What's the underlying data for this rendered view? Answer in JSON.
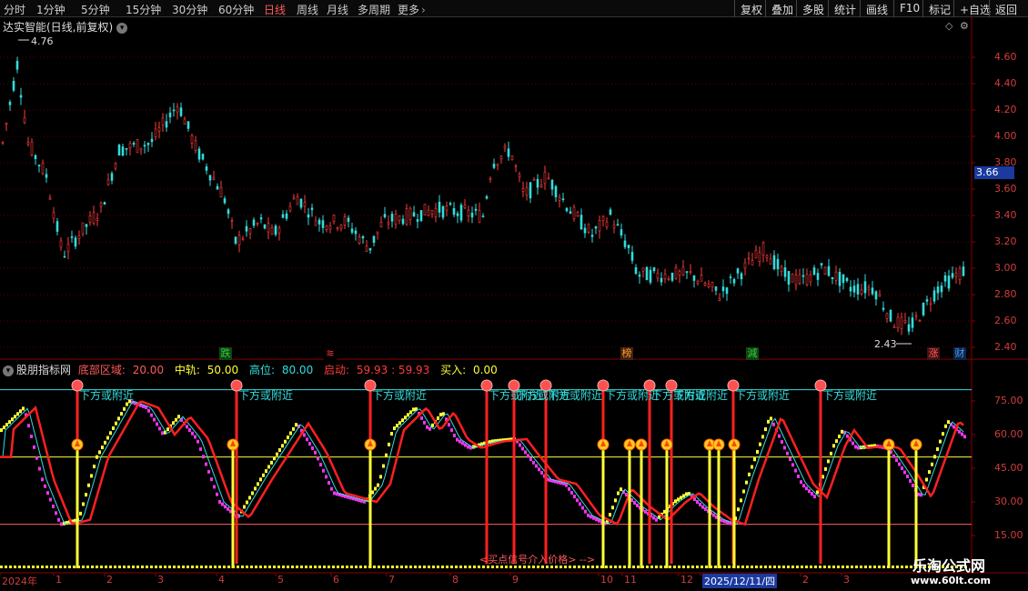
{
  "toolbar": {
    "periods": [
      "分时",
      "1分钟",
      "5分钟",
      "15分钟",
      "30分钟",
      "60分钟",
      "日线",
      "周线",
      "月线",
      "多周期",
      "更多"
    ],
    "active_period": "日线",
    "more_icon": "chevron-right-icon",
    "right_buttons": [
      "复权",
      "叠加",
      "多股",
      "统计",
      "画线",
      "F10",
      "标记",
      "+自选",
      "返回"
    ]
  },
  "main_chart": {
    "title": "达实智能(日线,前复权)",
    "price_labels": [
      "4.60",
      "4.40",
      "4.20",
      "4.00",
      "3.80",
      "3.60",
      "3.40",
      "3.20",
      "3.00",
      "2.80",
      "2.60",
      "2.40"
    ],
    "current_price": "3.66",
    "high_marker": "4.76",
    "low_marker": "2.43",
    "event_markers": [
      {
        "text": "跌",
        "color": "#2ecc40",
        "bg": "#114411"
      },
      {
        "text": "≋",
        "color": "#ff3b3b",
        "bg": "#000"
      },
      {
        "text": "榜",
        "color": "#ff9a2e",
        "bg": "#442211"
      },
      {
        "text": "減",
        "color": "#2ecc40",
        "bg": "#114411"
      },
      {
        "text": "涨",
        "color": "#ff5a5a",
        "bg": "#441111"
      },
      {
        "text": "财",
        "color": "#3aa0ff",
        "bg": "#112244"
      }
    ]
  },
  "indicator": {
    "name": "股朋指标网",
    "legend": [
      {
        "label": "底部区域:",
        "value": "20.00",
        "color": "#ff5a5a"
      },
      {
        "label": "中轨:",
        "value": "50.00",
        "color": "#ffff33"
      },
      {
        "label": "高位:",
        "value": "80.00",
        "color": "#33dddd"
      },
      {
        "label": "启动:",
        "value": "59.93 : 59.93",
        "color": "#ff3b3b"
      },
      {
        "label": "买入:",
        "value": "0.00",
        "color": "#ffff33"
      }
    ],
    "y_labels": [
      "75.00",
      "60.00",
      "45.00",
      "30.00",
      "15.00"
    ],
    "signal_text": "下方或附近",
    "bottom_note": "<买点信号介入价格>"
  },
  "date_axis": {
    "labels": [
      "2024年",
      "1",
      "2",
      "3",
      "4",
      "5",
      "6",
      "7",
      "8",
      "9",
      "10",
      "11",
      "12",
      "2025/12/11/四",
      "2",
      "3"
    ]
  },
  "watermark": {
    "line1": "乐淘公式网",
    "line2": "www.60lt.com"
  },
  "colors": {
    "up": "#ff3b3b",
    "down": "#33dddd",
    "bg": "#000000",
    "grid": "#7a0000"
  }
}
